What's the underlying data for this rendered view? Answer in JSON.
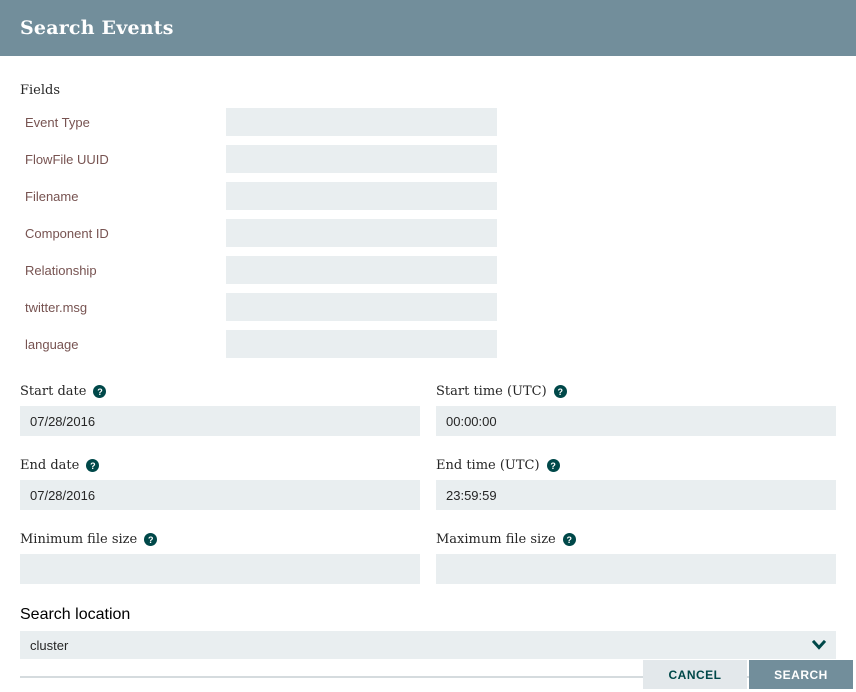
{
  "header": {
    "title": "Search Events"
  },
  "fields_section": {
    "heading": "Fields",
    "rows": [
      {
        "label": "Event Type",
        "value": ""
      },
      {
        "label": "FlowFile UUID",
        "value": ""
      },
      {
        "label": "Filename",
        "value": ""
      },
      {
        "label": "Component ID",
        "value": ""
      },
      {
        "label": "Relationship",
        "value": ""
      },
      {
        "label": "twitter.msg",
        "value": ""
      },
      {
        "label": "language",
        "value": ""
      }
    ]
  },
  "datetime_section": {
    "groups": [
      {
        "label": "Start date",
        "value": "07/28/2016"
      },
      {
        "label": "Start time (UTC)",
        "value": "00:00:00"
      },
      {
        "label": "End date",
        "value": "07/28/2016"
      },
      {
        "label": "End time (UTC)",
        "value": "23:59:59"
      },
      {
        "label": "Minimum file size",
        "value": ""
      },
      {
        "label": "Maximum file size",
        "value": ""
      }
    ]
  },
  "location_section": {
    "label": "Search location",
    "selected_option": "cluster"
  },
  "footer": {
    "cancel_label": "CANCEL",
    "search_label": "SEARCH"
  },
  "icons": {
    "help_glyph": "?"
  },
  "colors": {
    "header_bg": "#728E9B",
    "accent_teal": "#004849",
    "input_bg": "#E9EEF0",
    "field_label": "#775351",
    "search_button_bg": "#728E9B",
    "cancel_button_bg": "#E3E8EB"
  }
}
